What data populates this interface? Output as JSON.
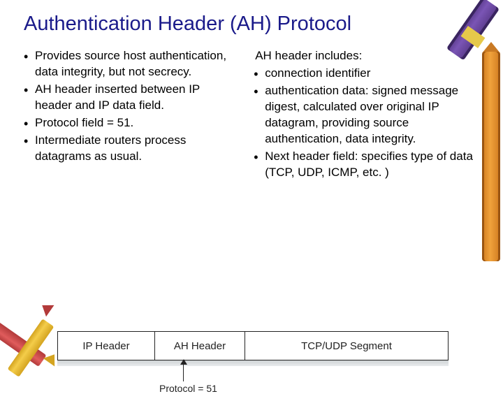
{
  "title": "Authentication Header (AH) Protocol",
  "left": {
    "b1": "Provides source host authentication, data integrity, but not secrecy.",
    "b2": "AH header inserted between IP header and IP data field.",
    "b3": "Protocol field = 51.",
    "b4": "Intermediate routers process datagrams as usual."
  },
  "right": {
    "heading": "AH header includes:",
    "b1": "connection identifier",
    "b2": "authentication data: signed message digest, calculated over original IP datagram, providing source authentication, data integrity.",
    "b3": "Next header field: specifies type of data (TCP, UDP, ICMP, etc. )"
  },
  "diagram": {
    "ip": "IP Header",
    "ah": "AH Header",
    "seg": "TCP/UDP Segment",
    "protocol": "Protocol = 51"
  }
}
